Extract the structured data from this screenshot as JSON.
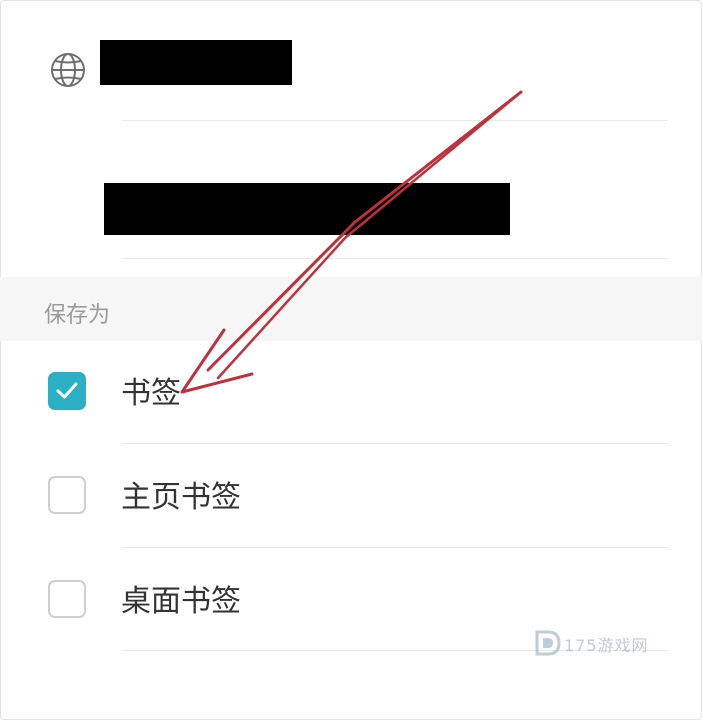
{
  "section": {
    "label": "保存为"
  },
  "options": [
    {
      "label": "书签",
      "checked": true
    },
    {
      "label": "主页书签",
      "checked": false
    },
    {
      "label": "桌面书签",
      "checked": false
    }
  ],
  "watermark": {
    "text": "175游戏网"
  },
  "colors": {
    "accent": "#2aafc4",
    "arrow": "#c0303a"
  }
}
